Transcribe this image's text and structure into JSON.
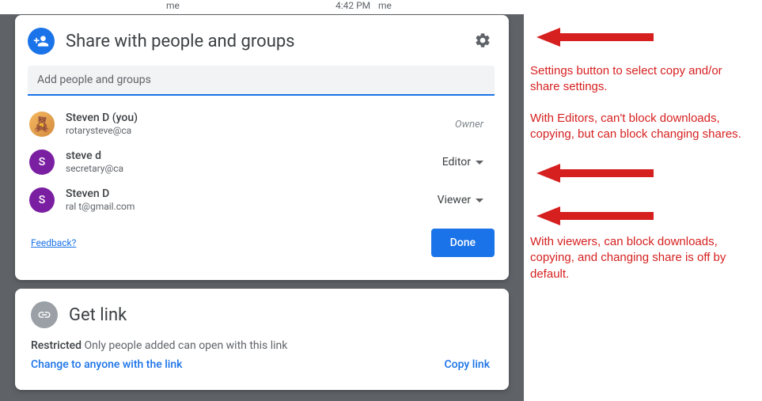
{
  "background": {
    "me1": "me",
    "time": "4:42 PM",
    "me2": "me"
  },
  "share": {
    "title": "Share with people and groups",
    "placeholder": "Add people and groups",
    "people": [
      {
        "name": "Steven D (you)",
        "email": "rotarysteve@ca",
        "role": "Owner",
        "avatar": "🧸"
      },
      {
        "name": "steve d",
        "email": "secretary@ca",
        "role": "Editor",
        "avatar": "S"
      },
      {
        "name": "Steven D",
        "email": "ral        t@gmail.com",
        "role": "Viewer",
        "avatar": "S"
      }
    ],
    "feedback": "Feedback?",
    "done": "Done"
  },
  "link": {
    "title": "Get link",
    "restricted_label": "Restricted",
    "restricted_desc": "Only people added can open with this link",
    "change": "Change to anyone with the link",
    "copy": "Copy link"
  },
  "annotations": {
    "a1": "Settings button to select copy and/or share settings.",
    "a2": "With Editors, can't block downloads, copying, but can block changing shares.",
    "a3": "With viewers, can block downloads, copying, and changing share is off by default."
  }
}
